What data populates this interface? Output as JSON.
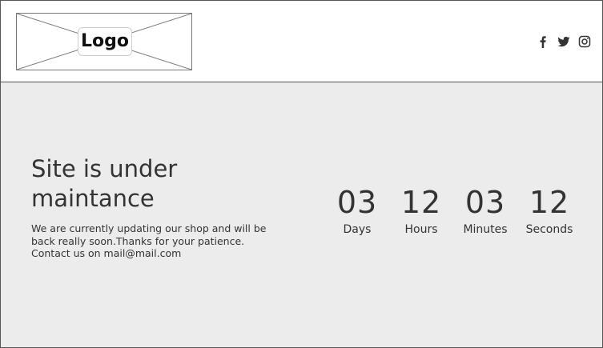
{
  "header": {
    "logo_text": "Logo",
    "social": [
      {
        "icon": "facebook-icon"
      },
      {
        "icon": "twitter-icon"
      },
      {
        "icon": "instagram-icon"
      }
    ]
  },
  "main": {
    "headline": "Site is under maintance",
    "message": "We are currently updating our shop and will be back really soon.Thanks for your patience. Contact us on mail@mail.com",
    "countdown": [
      {
        "value": "03",
        "label": "Days"
      },
      {
        "value": "12",
        "label": "Hours"
      },
      {
        "value": "03",
        "label": "Minutes"
      },
      {
        "value": "12",
        "label": "Seconds"
      }
    ]
  },
  "colors": {
    "page_background": "#ececec",
    "header_background": "#ffffff",
    "text": "#333333",
    "border": "#555555"
  }
}
